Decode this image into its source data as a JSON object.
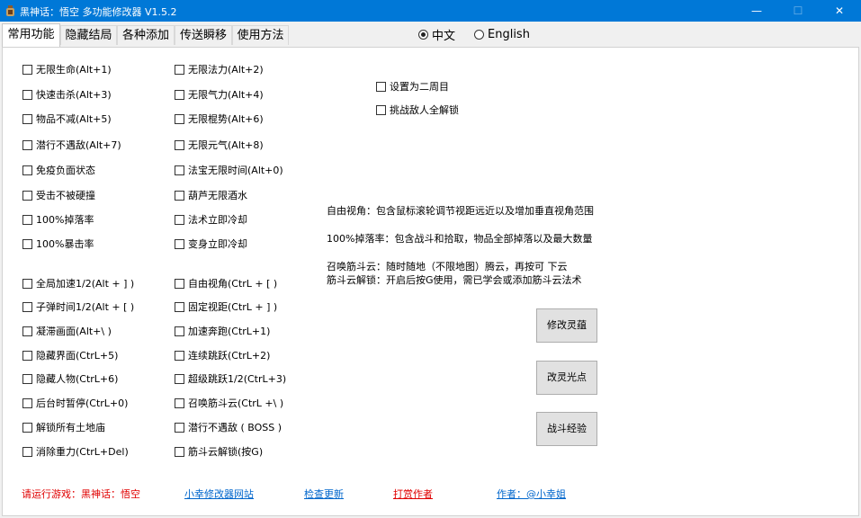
{
  "window": {
    "title": "黑神话：悟空 多功能修改器  V1.5.2",
    "min_glyph": "—",
    "max_glyph": "☐",
    "close_glyph": "✕"
  },
  "tabs": [
    "常用功能",
    "隐藏结局",
    "各种添加",
    "传送瞬移",
    "使用方法"
  ],
  "language": {
    "chinese": "中文",
    "english": "English",
    "selected": "中文"
  },
  "cheats_left": [
    "无限生命(Alt+1)",
    "快速击杀(Alt+3)",
    "物品不减(Alt+5)",
    "潜行不遇敌(Alt+7)",
    "免疫负面状态",
    "受击不被硬撞",
    "100%掉落率",
    "100%暴击率",
    "全局加速1/2(Alt + ] )",
    "子弹时间1/2(Alt + [ )",
    "凝滞画面(Alt+\\ )",
    "隐藏界面(CtrL+5)",
    "隐藏人物(CtrL+6)",
    "后台时暂停(CtrL+0)",
    "解锁所有土地庙",
    "消除重力(CtrL+Del)"
  ],
  "cheats_right": [
    "无限法力(Alt+2)",
    "无限气力(Alt+4)",
    "无限棍势(Alt+6)",
    "无限元气(Alt+8)",
    "法宝无限时间(Alt+0)",
    "葫芦无限酒水",
    "法术立即冷却",
    "变身立即冷却",
    "自由视角(CtrL + [ )",
    "固定视距(CtrL + ] )",
    "加速奔跑(CtrL+1)",
    "连续跳跃(CtrL+2)",
    "超级跳跃1/2(CtrL+3)",
    "召唤筋斗云(CtrL +\\ )",
    "潜行不遇敌 ( BOSS )",
    "筋斗云解锁(按G)"
  ],
  "options": [
    "设置为二周目",
    "挑战敌人全解锁"
  ],
  "notes": [
    "自由视角：包含鼠标滚轮调节视距远近以及增加垂直视角范围",
    "100%掉落率：包含战斗和拾取，物品全部掉落以及最大数量",
    "召唤筋斗云：随时随地（不限地图）腾云，再按可 下云",
    "筋斗云解锁：开启后按G使用，需已学会或添加筋斗云法术"
  ],
  "action_buttons": [
    "修改灵蕴",
    "改灵光点",
    "战斗经验"
  ],
  "footer": {
    "status": "请运行游戏：黑神话：悟空",
    "site": "小幸修改器网站",
    "update": "检查更新",
    "donate": "打赏作者",
    "author": "作者：@小幸姐"
  }
}
